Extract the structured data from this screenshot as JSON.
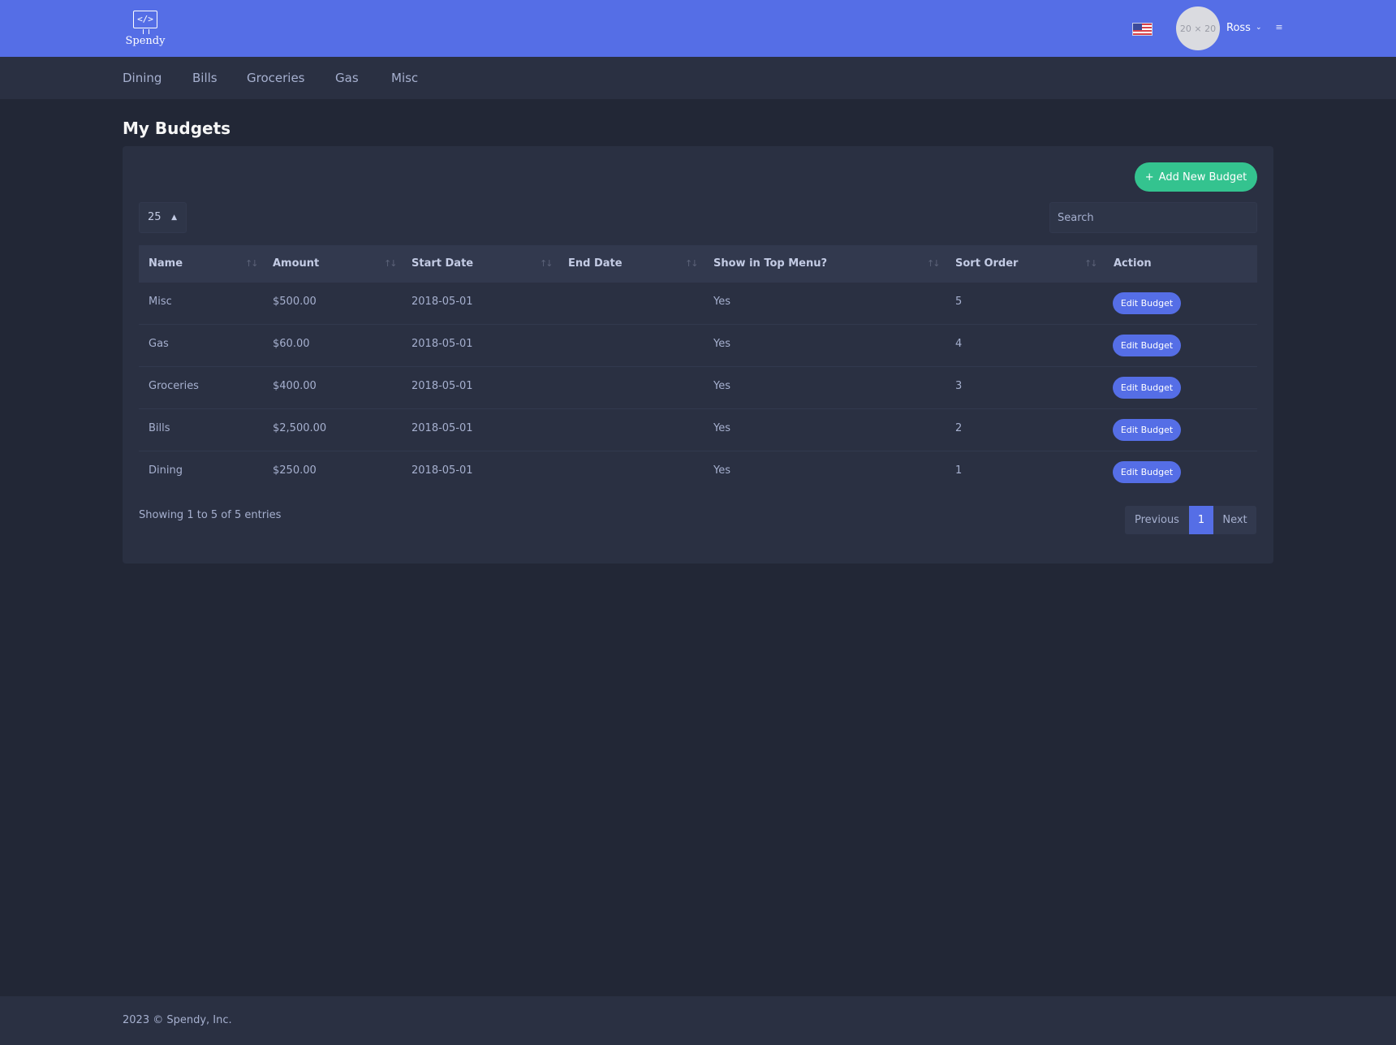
{
  "brand": {
    "icon_text": "</>",
    "name": "Spendy"
  },
  "header": {
    "avatar_placeholder": "20 × 20",
    "user_name": "Ross",
    "chevron": "⌄",
    "menu_icon": "≡"
  },
  "subnav": {
    "items": [
      {
        "label": "Dining"
      },
      {
        "label": "Bills"
      },
      {
        "label": "Groceries"
      },
      {
        "label": "Gas"
      },
      {
        "label": "Misc"
      }
    ]
  },
  "page": {
    "title": "My Budgets"
  },
  "toolbar": {
    "add_label": "Add New Budget",
    "add_icon": "+",
    "page_length": "25",
    "search_placeholder": "Search"
  },
  "table": {
    "columns": [
      "Name",
      "Amount",
      "Start Date",
      "End Date",
      "Show in Top Menu?",
      "Sort Order",
      "Action"
    ],
    "sort_icon": "↑↓",
    "rows": [
      {
        "name": "Misc",
        "amount": "$500.00",
        "start": "2018-05-01",
        "end": "",
        "top_menu": "Yes",
        "sort": "5",
        "action": "Edit Budget"
      },
      {
        "name": "Gas",
        "amount": "$60.00",
        "start": "2018-05-01",
        "end": "",
        "top_menu": "Yes",
        "sort": "4",
        "action": "Edit Budget"
      },
      {
        "name": "Groceries",
        "amount": "$400.00",
        "start": "2018-05-01",
        "end": "",
        "top_menu": "Yes",
        "sort": "3",
        "action": "Edit Budget"
      },
      {
        "name": "Bills",
        "amount": "$2,500.00",
        "start": "2018-05-01",
        "end": "",
        "top_menu": "Yes",
        "sort": "2",
        "action": "Edit Budget"
      },
      {
        "name": "Dining",
        "amount": "$250.00",
        "start": "2018-05-01",
        "end": "",
        "top_menu": "Yes",
        "sort": "1",
        "action": "Edit Budget"
      }
    ]
  },
  "pagination": {
    "info": "Showing 1 to 5 of 5 entries",
    "previous": "Previous",
    "current": "1",
    "next": "Next"
  },
  "footer": {
    "text": "2023 © Spendy, Inc."
  },
  "colors": {
    "primary": "#556ee6",
    "success": "#34c38f",
    "background": "#222736",
    "card": "#2a3042"
  }
}
